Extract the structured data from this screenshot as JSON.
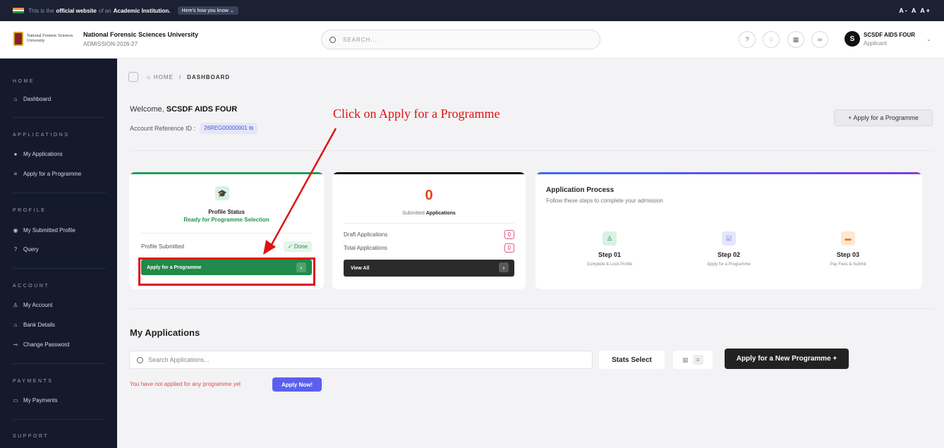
{
  "gov_banner": {
    "prefix": "This is the",
    "official": "official website",
    "of_an": "of an",
    "institution": "Academic Institution.",
    "how_button": "Here's how you know ⌄",
    "font_sizes": "A-  A  A+"
  },
  "header": {
    "logo_text": "National Forensic Sciences University",
    "university_name": "National Forensic Sciences University",
    "subtitle": "ADMISSION-2026-27",
    "search_placeholder": "SEARCH...",
    "avatar_letter": "S",
    "user_name": "SCSDF AIDS FOUR",
    "user_role": "Applicant"
  },
  "sidebar": {
    "home_section": "HOME",
    "dashboard": "Dashboard",
    "applications_section": "APPLICATIONS",
    "my_applications": "My Applications",
    "apply_programme": "Apply for a Programme",
    "profile_section": "PROFILE",
    "my_submitted_profile": "My Submitted Profile",
    "query": "Query",
    "account_section": "ACCOUNT",
    "my_account": "My Account",
    "bank_details": "Bank Details",
    "change_password": "Change Password",
    "payments_section": "PAYMENTS",
    "my_payments": "My Payments",
    "support_section": "SUPPORT"
  },
  "breadcrumb": {
    "home": "HOME",
    "sep": "/",
    "current": "DASHBOARD"
  },
  "welcome": {
    "greeting": "Welcome,",
    "name": "SCSDF AIDS FOUR",
    "ref_label": "Account Reference ID :",
    "ref_id": "26REG00000001"
  },
  "apply_top_button": "+   Apply for a Programme",
  "annotation": "Click on Apply for a Programme",
  "profile_card": {
    "title": "Profile Status",
    "status": "Ready for Programme Selection",
    "submitted_label": "Profile Submitted",
    "done_label": "✓ Done",
    "apply_button": "Apply for a Programme"
  },
  "applications_card": {
    "count": "0",
    "caption_prefix": "Submitted",
    "caption_bold": "Applications",
    "draft_label": "Draft Applications",
    "draft_count": "0",
    "total_label": "Total Applications",
    "total_count": "0",
    "view_all": "View All"
  },
  "process_card": {
    "title": "Application Process",
    "subtitle": "Follow these steps to complete your admission",
    "steps": [
      {
        "title": "Step 01",
        "desc": "Complete & Lock Profile"
      },
      {
        "title": "Step 02",
        "desc": "Apply for a Programme"
      },
      {
        "title": "Step 03",
        "desc": "Pay Fees & Submit"
      }
    ]
  },
  "my_applications": {
    "heading": "My Applications",
    "search_placeholder": "Search Applications...",
    "stats_select": "Stats Select",
    "new_button": "Apply for a New Programme  +",
    "empty_message": "You have not applied for any programme yet",
    "apply_now": "Apply Now!"
  },
  "colors": {
    "sidebar_bg": "#141a2b",
    "green_button": "#218a4a",
    "annotation_red": "#e01010",
    "accent_purple": "#5b5ff0",
    "count_orange": "#e0451b"
  }
}
